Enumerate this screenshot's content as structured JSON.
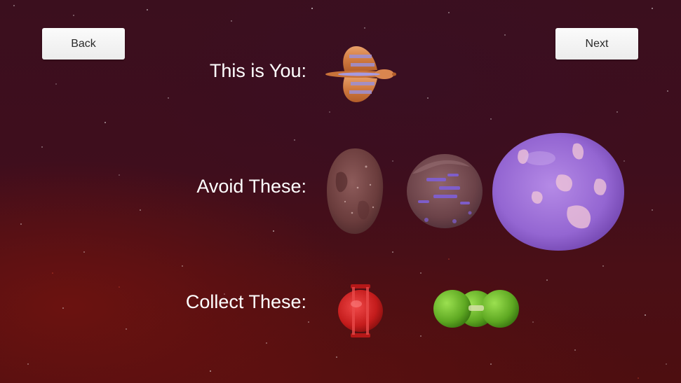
{
  "buttons": {
    "back_label": "Back",
    "next_label": "Next"
  },
  "rows": {
    "you_label": "This is You:",
    "avoid_label": "Avoid These:",
    "collect_label": "Collect These:"
  },
  "sprites": {
    "player": "player-ship-icon",
    "avoid": [
      "brown-blob-icon",
      "purple-striped-blob-icon",
      "large-purple-blob-icon"
    ],
    "collect": [
      "red-capsule-icon",
      "green-triple-sphere-icon"
    ]
  },
  "colors": {
    "button_bg": "#f2f2f2",
    "label_text": "#ffffff",
    "player": "#d9864f",
    "player_stripes": "#9b8fd6",
    "brown_blob": "#7a4a4a",
    "purple_blob": "#a178d6",
    "red_pickup": "#d42020",
    "green_pickup": "#6cc226"
  }
}
